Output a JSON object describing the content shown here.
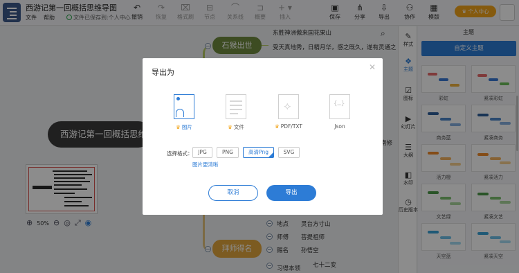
{
  "window": {
    "title": "西游记第一回概括思维导图",
    "menu": [
      "文件",
      "帮助"
    ],
    "save_status": "文件已保存到:个人中心"
  },
  "toolbar": {
    "undo": "撤销",
    "redo": "恢复",
    "format_painter": "格式刷",
    "node": "节点",
    "relation": "关系线",
    "summary": "概要",
    "insert": "插入",
    "save": "保存",
    "share": "分享",
    "export": "导出",
    "collaborate": "协作",
    "template": "模版",
    "account": "个人中心"
  },
  "mindmap": {
    "root": "西游记第一回概括思维导图",
    "branch1": {
      "label": "石猴出世",
      "leaves": [
        "东胜神洲傲来国花果山",
        "受天真地秀，日精月华，感之既久，遂有灵通之"
      ]
    },
    "right_edge_text": "南修",
    "branch2": {
      "label": "拜师得名",
      "leaves": [
        {
          "key": "地点",
          "value": "灵台方寸山"
        },
        {
          "key": "师傅",
          "value": "菩提祖师"
        },
        {
          "key": "赐名",
          "value": "孙悟空"
        },
        {
          "key": "习得本领",
          "value": "七十二变"
        }
      ]
    }
  },
  "zoom": {
    "level": "50%"
  },
  "rail": {
    "items": [
      "样式",
      "主题",
      "图标",
      "幻灯片",
      "大纲",
      "水印",
      "历史版本"
    ],
    "active_index": 1
  },
  "theme_panel": {
    "title": "主题",
    "custom_button": "自定义主题",
    "themes": [
      "彩虹",
      "紧凑彩虹",
      "商务蓝",
      "紧凑商务",
      "活力橙",
      "紧凑活力",
      "文艺绿",
      "紧凑文艺",
      "天空蓝",
      "紧凑天空"
    ]
  },
  "dialog": {
    "title": "导出为",
    "formats": [
      {
        "label": "图片",
        "active": true
      },
      {
        "label": "文件",
        "active": false
      },
      {
        "label": "PDF/TXT",
        "active": false
      },
      {
        "label": "Json",
        "active": false
      }
    ],
    "image_format_label": "选择格式：",
    "image_formats": [
      "JPG",
      "PNG",
      "高清Png",
      "SVG"
    ],
    "selected_image_format": "高清Png",
    "clearer_link": "图片更清晰",
    "cancel": "取消",
    "confirm": "导出"
  },
  "colors": {
    "accent": "#2d7cd6",
    "vip": "#f2a51a",
    "branch_green": "#6f8b3e",
    "branch_gold": "#e2a63d",
    "root": "#3b3b3b"
  }
}
